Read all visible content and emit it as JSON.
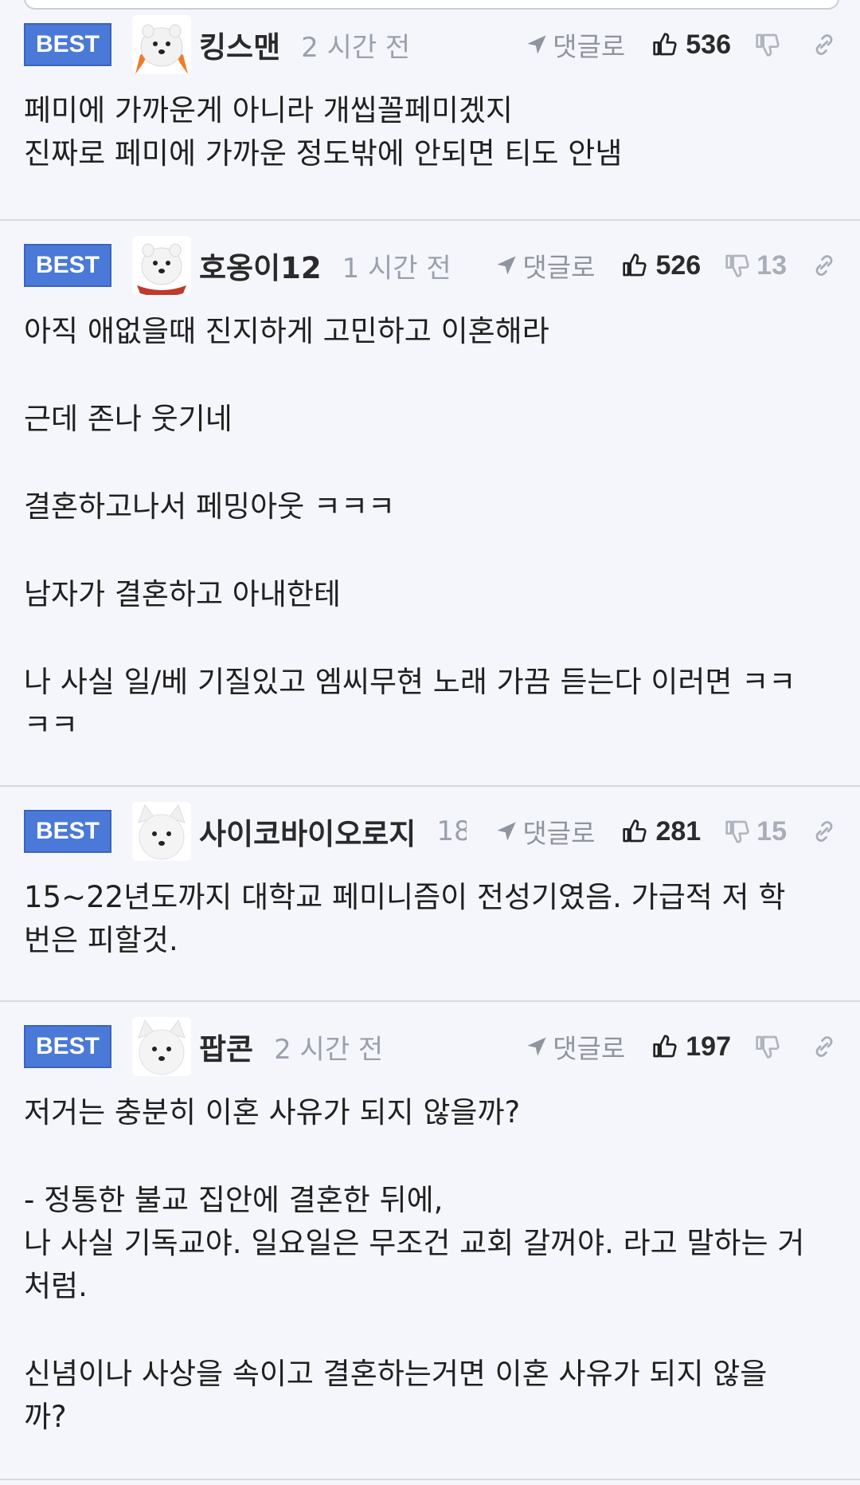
{
  "comments": [
    {
      "badge": "BEST",
      "nickname": "킹스맨",
      "time": "2 시간 전",
      "reply_label": "댓글로",
      "likes": "536",
      "dislikes": "",
      "lines": [
        "페미에 가까운게 아니라 개씹꼴페미겠지",
        "진짜로 페미에 가까운 정도밖에 안되면 티도 안냄"
      ]
    },
    {
      "badge": "BEST",
      "nickname": "호옹이12",
      "time": "1 시간 전",
      "reply_label": "댓글로",
      "likes": "526",
      "dislikes": "13",
      "lines": [
        "아직 애없을때 진지하게 고민하고 이혼해라",
        "",
        "근데 존나 웃기네",
        "",
        "결혼하고나서 페밍아웃 ㅋㅋㅋ",
        "",
        "남자가 결혼하고 아내한테",
        "",
        "나 사실 일/베 기질있고 엠씨무현 노래 가끔 듣는다 이러면 ㅋㅋ",
        "ㅋㅋ"
      ]
    },
    {
      "badge": "BEST",
      "nickname": "사이코바이오로지",
      "time": "18",
      "reply_label": "댓글로",
      "likes": "281",
      "dislikes": "15",
      "lines": [
        "15~22년도까지 대학교 페미니즘이 전성기였음. 가급적 저 학",
        "번은 피할것."
      ]
    },
    {
      "badge": "BEST",
      "nickname": "팝콘",
      "time": "2 시간 전",
      "reply_label": "댓글로",
      "likes": "197",
      "dislikes": "",
      "lines": [
        "저거는 충분히 이혼 사유가 되지 않을까?",
        "",
        "- 정통한 불교 집안에 결혼한 뒤에,",
        "나 사실 기독교야. 일요일은 무조건 교회 갈꺼야. 라고 말하는 거",
        "처럼.",
        "",
        "신념이나 사상을 속이고 결혼하는거면 이혼 사유가 되지 않을",
        "까?"
      ]
    }
  ]
}
